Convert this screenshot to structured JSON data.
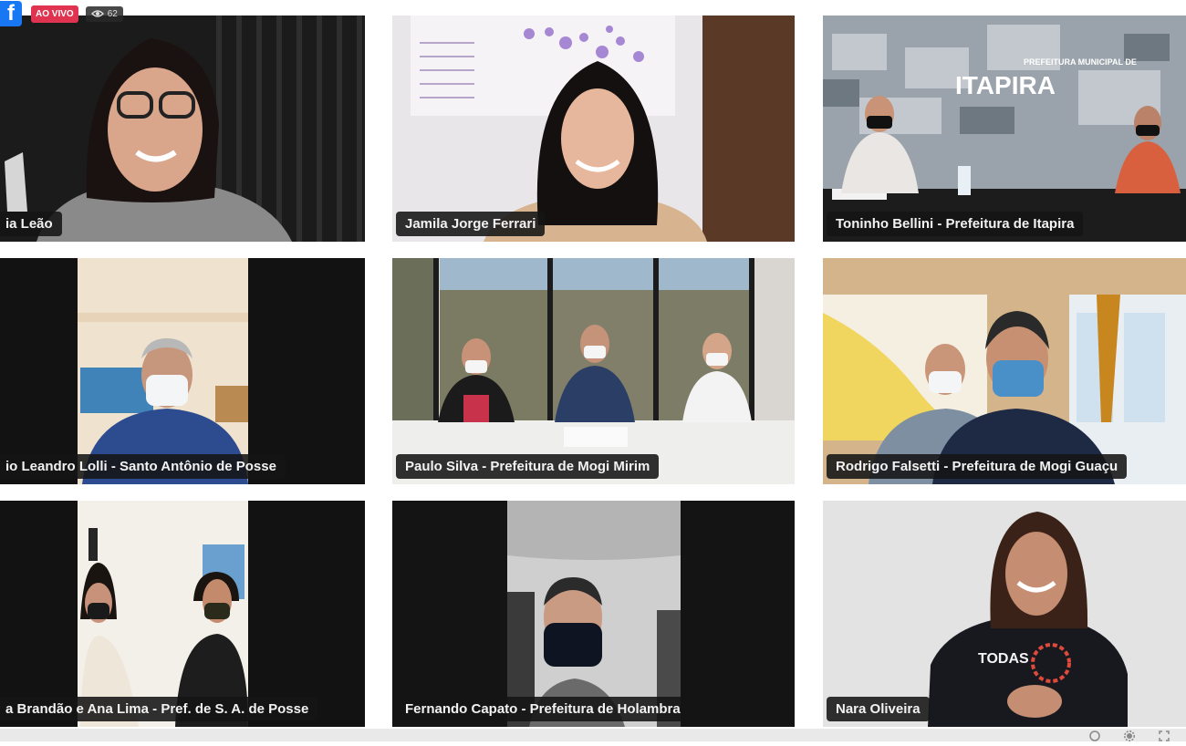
{
  "overlay": {
    "facebook_glyph": "f",
    "live_label": "AO VIVO",
    "viewer_count": "62",
    "viewer_icon": "eye-icon"
  },
  "tiles": [
    {
      "name": "...ia Leão",
      "label": "ia Leão"
    },
    {
      "name": "Jamila Jorge Ferrari",
      "label": "Jamila Jorge Ferrari"
    },
    {
      "name": "Toninho Bellini",
      "label": "Toninho Bellini - Prefeitura de Itapira"
    },
    {
      "name": "Leandro Lolli",
      "label": "io Leandro Lolli - Santo Antônio de Posse"
    },
    {
      "name": "Paulo Silva",
      "label": "Paulo Silva - Prefeitura de Mogi Mirim"
    },
    {
      "name": "Rodrigo Falsetti",
      "label": "Rodrigo Falsetti - Prefeitura de Mogi Guaçu"
    },
    {
      "name": "Brandão e Ana Lima",
      "label": "a Brandão e Ana Lima - Pref. de S. A. de Posse"
    },
    {
      "name": "Fernando Capato",
      "label": "Fernando Capato - Prefeitura de Holambra"
    },
    {
      "name": "Nara Oliveira",
      "label": "Nara Oliveira"
    }
  ],
  "scene_text": {
    "itapira_sign_small": "PREFEITURA MUNICIPAL DE",
    "itapira_sign_big": "ITAPIRA",
    "shirt_text": "TODAS"
  },
  "colors": {
    "label_bg": "#141414",
    "live_red": "#e0334f",
    "facebook_blue": "#1877f2",
    "mask_blue": "#4a90c8"
  }
}
